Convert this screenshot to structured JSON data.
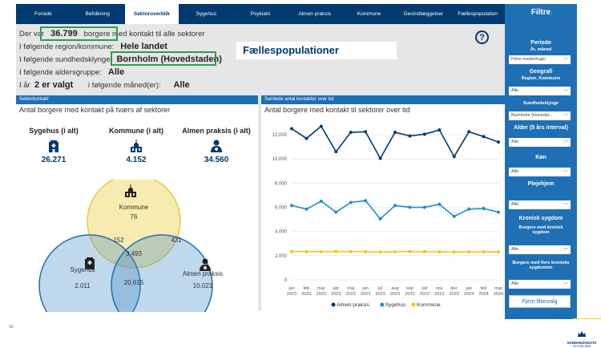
{
  "nav": {
    "tabs": [
      {
        "label": "Forside",
        "active": false
      },
      {
        "label": "Befolkning",
        "active": false
      },
      {
        "label": "Sektoroverblik",
        "active": true
      },
      {
        "label": "Sygehus",
        "active": false
      },
      {
        "label": "Psykiatri",
        "active": false
      },
      {
        "label": "Almen praksis",
        "active": false
      },
      {
        "label": "Kommune",
        "active": false
      },
      {
        "label": "Genindlæggelser",
        "active": false
      },
      {
        "label": "Fællespopulation",
        "active": false
      }
    ]
  },
  "summary": {
    "line1_prefix": "Der var",
    "line1_value": "36.799",
    "line1_suffix": "borgere med kontakt til alle sektorer",
    "region_label": "I følgende region/kommune:",
    "region_value": "Hele landet",
    "cluster_label": "I følgende sundhedsklynge:",
    "cluster_value": "Bornholm (Hovedstaden)",
    "age_label": "I følgende aldersgruppe:",
    "age_value": "Alle",
    "year_prefix": "I år",
    "year_value": "2 er valgt",
    "month_label": "i følgende måned(er):",
    "month_value": "Alle",
    "page_title": "Fællespopulationer",
    "help": "?"
  },
  "sektorkontakt": {
    "panel_title": "Sektorkontakt",
    "subtitle": "Antal borgere med kontakt på tværs af sektorer",
    "stats": [
      {
        "label": "Sygehus (i alt)",
        "value": "26.271",
        "icon": "hospital-icon"
      },
      {
        "label": "Kommune (i alt)",
        "value": "4.152",
        "icon": "town-hall-icon"
      },
      {
        "label": "Almen praksis (i alt)",
        "value": "34.560",
        "icon": "doctor-icon"
      }
    ],
    "venn": {
      "kommune_label": "Kommune",
      "kommune_value": "76",
      "sygehus_label": "Sygehus",
      "sygehus_value": "2.011",
      "almen_label": "Almen praksis",
      "almen_value": "10.021",
      "sygehus_kommune": "152",
      "kommune_almen": "431",
      "all_three": "3.493",
      "sygehus_almen": "20.615"
    }
  },
  "over_tid": {
    "panel_title": "Samlede antal kontakter over tid",
    "subtitle": "Antal borgere med kontakt til sektorer over tid"
  },
  "chart_data": {
    "type": "line",
    "title": "Antal borgere med kontakt til sektorer over tid",
    "x": [
      "jan 2023",
      "feb 2023",
      "mar 2023",
      "apr 2023",
      "maj 2023",
      "jun 2023",
      "jul 2023",
      "aug 2023",
      "sep 2023",
      "okt 2023",
      "nov 2023",
      "dec 2023",
      "jan 2024",
      "feb 2024",
      "mar 2024"
    ],
    "x_tick_top": [
      "jan",
      "feb",
      "mar",
      "apr",
      "maj",
      "jun",
      "jul",
      "aug",
      "sep",
      "okt",
      "nov",
      "dec",
      "jan",
      "feb",
      "mar"
    ],
    "x_tick_bottom": [
      "2023",
      "2023",
      "2023",
      "2023",
      "2023",
      "2023",
      "2023",
      "2023",
      "2023",
      "2023",
      "2023",
      "2023",
      "2024",
      "2024",
      "2024"
    ],
    "yticks": [
      "0",
      "2.000",
      "4.000",
      "6.000",
      "8.000",
      "10.000",
      "12.000"
    ],
    "ylim": [
      0,
      13000
    ],
    "series": [
      {
        "name": "Almen praksis",
        "color": "#003a70",
        "values": [
          12500,
          11700,
          12700,
          10600,
          12200,
          12250,
          10050,
          12200,
          11900,
          12050,
          12400,
          10200,
          12250,
          11850,
          11400
        ]
      },
      {
        "name": "Sygehus",
        "color": "#1a8fcb",
        "values": [
          6150,
          5850,
          6500,
          5600,
          6400,
          6550,
          5050,
          6150,
          6000,
          6000,
          6250,
          5250,
          5850,
          5900,
          5600
        ]
      },
      {
        "name": "Kommune",
        "color": "#f5c518",
        "values": [
          2350,
          2340,
          2330,
          2350,
          2340,
          2330,
          2300,
          2320,
          2340,
          2330,
          2320,
          2300,
          2320,
          2320,
          2310
        ]
      }
    ],
    "legend_position": "bottom",
    "grid": true
  },
  "filters": {
    "title": "Filtre",
    "periode_label": "Periode",
    "periode_sub": "År, måned",
    "periode_value": "Flere markeringer",
    "geografi_label": "Geografi",
    "geografi_sub": "Region, Kommune",
    "geografi_value": "Alle",
    "klynge_label": "Sundhedsklynge",
    "klynge_value": "Bornholm (Hovedst...",
    "alder_label": "Alder (5 års interval)",
    "alder_value": "Alle",
    "koen_label": "Køn",
    "koen_value": "Alle",
    "plejehjem_label": "Plejehjem",
    "plejehjem_value": "Alle",
    "kronisk_label": "Kronisk sygdom",
    "kronisk_sub": "Borgere med kronisk sygdom",
    "kronisk_value": "Alle",
    "flere_kroniske_sub": "Borgere med flere kroniske sygdomme",
    "flere_kroniske_value": "Alle",
    "reset_label": "Fjern filtervalg"
  },
  "footer": {
    "page_number": "58",
    "logo_line1": "SUNDHEDSDATA",
    "logo_line2": "STYRELSEN"
  }
}
